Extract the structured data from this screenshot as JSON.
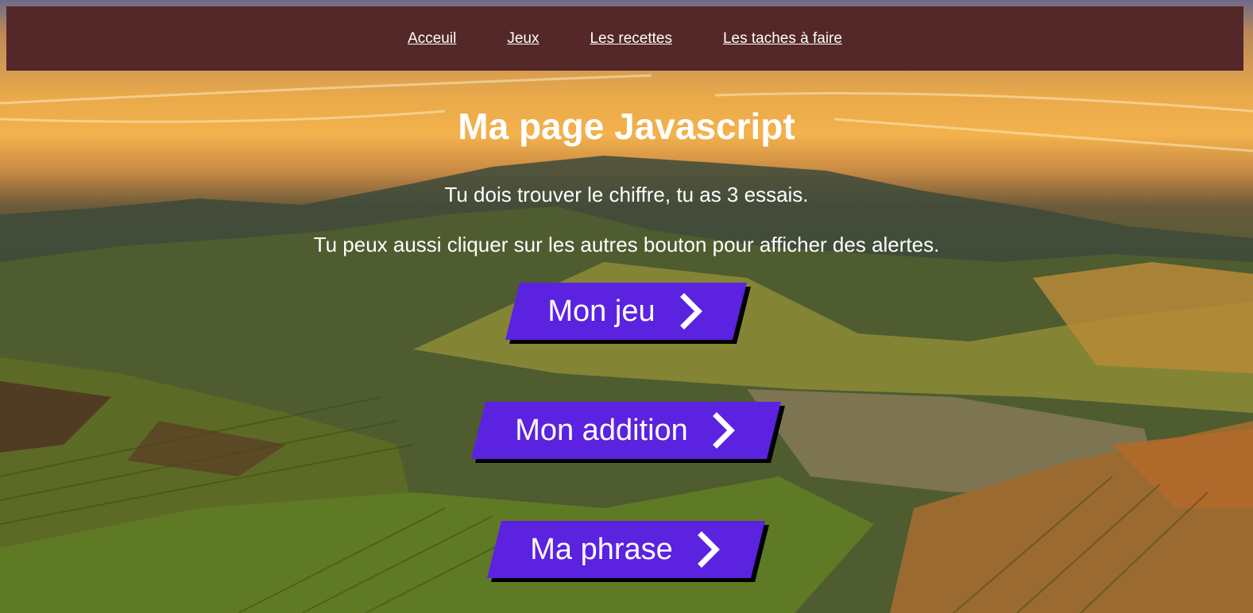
{
  "nav": {
    "items": [
      {
        "label": "Acceuil"
      },
      {
        "label": "Jeux"
      },
      {
        "label": "Les recettes"
      },
      {
        "label": "Les taches à faire"
      }
    ]
  },
  "main": {
    "title": "Ma page Javascript",
    "line1": "Tu dois trouver le chiffre, tu as 3 essais.",
    "line2": "Tu peux aussi cliquer sur les autres bouton pour afficher des alertes."
  },
  "buttons": [
    {
      "label": "Mon jeu",
      "icon": "chevron-right-icon"
    },
    {
      "label": "Mon addition",
      "icon": "chevron-right-icon"
    },
    {
      "label": "Ma phrase",
      "icon": "chevron-right-icon"
    }
  ],
  "colors": {
    "nav_background": "#542828",
    "button_accent": "#5b22e0",
    "button_shadow": "#000000",
    "text": "#ffffff"
  }
}
